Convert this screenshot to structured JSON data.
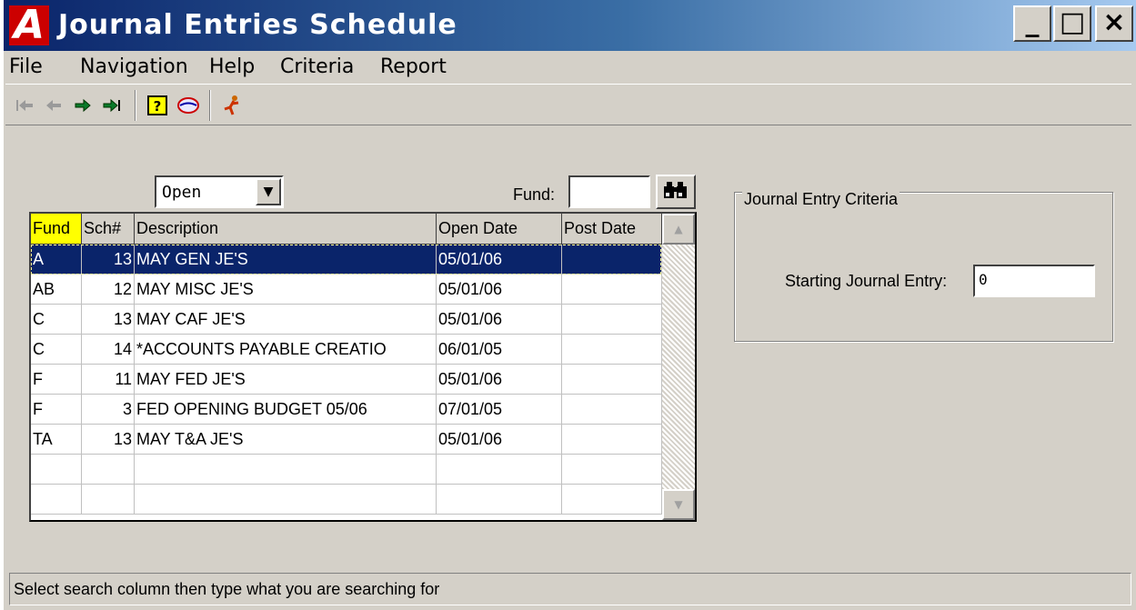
{
  "window": {
    "app_icon_letter": "A",
    "title": "Journal Entries Schedule",
    "minimize_glyph": "_",
    "maximize_glyph": "□",
    "close_glyph": "×"
  },
  "menu": [
    "File",
    "Navigation",
    "Help",
    "Criteria",
    "Report"
  ],
  "toolbar": {
    "icons": [
      "first-record-icon",
      "previous-record-icon",
      "next-record-icon",
      "last-record-icon",
      "help-icon",
      "globe-icon",
      "run-icon"
    ]
  },
  "filter": {
    "status_value": "Open",
    "fund_label": "Fund:",
    "fund_value": ""
  },
  "table": {
    "columns": [
      "Fund",
      "Sch#",
      "Description",
      "Open Date",
      "Post Date"
    ],
    "rows": [
      {
        "fund": "A",
        "sch": "13",
        "description": "MAY GEN JE'S",
        "open_date": "05/01/06",
        "post_date": ""
      },
      {
        "fund": "AB",
        "sch": "12",
        "description": "MAY MISC JE'S",
        "open_date": "05/01/06",
        "post_date": ""
      },
      {
        "fund": "C",
        "sch": "13",
        "description": "MAY CAF JE'S",
        "open_date": "05/01/06",
        "post_date": ""
      },
      {
        "fund": "C",
        "sch": "14",
        "description": "*ACCOUNTS PAYABLE CREATIO",
        "open_date": "06/01/05",
        "post_date": ""
      },
      {
        "fund": "F",
        "sch": "11",
        "description": "MAY FED JE'S",
        "open_date": "05/01/06",
        "post_date": ""
      },
      {
        "fund": "F",
        "sch": "3",
        "description": "FED OPENING BUDGET 05/06",
        "open_date": "07/01/05",
        "post_date": ""
      },
      {
        "fund": "TA",
        "sch": "13",
        "description": "MAY T&A JE'S",
        "open_date": "05/01/06",
        "post_date": ""
      },
      {
        "fund": "",
        "sch": "",
        "description": "",
        "open_date": "",
        "post_date": ""
      },
      {
        "fund": "",
        "sch": "",
        "description": "",
        "open_date": "",
        "post_date": ""
      }
    ],
    "selected_row": 0
  },
  "criteria": {
    "group_title": "Journal Entry Criteria",
    "starting_je_label": "Starting Journal Entry:",
    "starting_je_value": "0"
  },
  "status_bar": {
    "text": "Select search column then type what you are searching for"
  }
}
